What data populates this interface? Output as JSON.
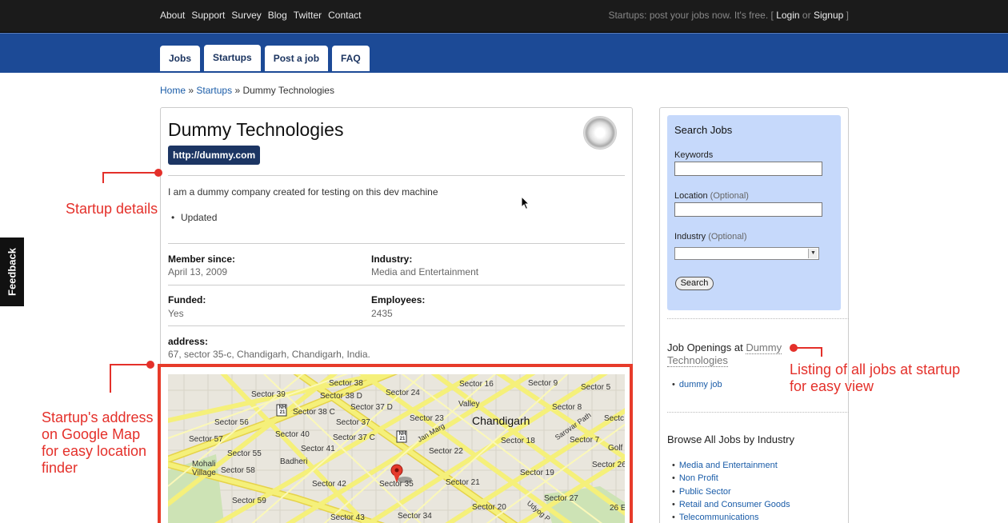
{
  "topbar": {
    "links": [
      "About",
      "Support",
      "Survey",
      "Blog",
      "Twitter",
      "Contact"
    ],
    "promo": "Startups: post your jobs now. It's free. [",
    "login": "Login",
    "or": "or",
    "signup": "Signup",
    "close_bracket": "]"
  },
  "tabs": [
    "Jobs",
    "Startups",
    "Post a job",
    "FAQ"
  ],
  "active_tab": "Startups",
  "breadcrumb": {
    "home": "Home",
    "sep": "»",
    "startups": "Startups",
    "current": "Dummy Technologies"
  },
  "company": {
    "name": "Dummy Technologies",
    "url": "http://dummy.com",
    "description": "I am a dummy company created for testing on this dev machine",
    "updates": [
      "Updated"
    ],
    "member_since_label": "Member since:",
    "member_since": "April 13, 2009",
    "industry_label": "Industry:",
    "industry": "Media and Entertainment",
    "funded_label": "Funded:",
    "funded": "Yes",
    "employees_label": "Employees:",
    "employees": "2435",
    "address_label": "address:",
    "address": "67, sector 35-c, Chandigarh, Chandigarh, India."
  },
  "map": {
    "labels": [
      "Sector 38",
      "Sector 39",
      "Sector 38 D",
      "Sector 24",
      "Sector 16",
      "Sector 9",
      "Sector 5",
      "Sector 38 C",
      "Sector 37 D",
      "Sector 56",
      "Sector 37",
      "Sector 23",
      "Chandigarh",
      "Sector 8",
      "Sector 40",
      "Sector 37 C",
      "Sector 57",
      "Sector 41",
      "Sector 22",
      "Sector 18",
      "Sector 7",
      "Sector 55",
      "Mohali Village",
      "Sector 58",
      "Badheri",
      "Sector 26",
      "Sector 42",
      "Sector 35",
      "Sector 21",
      "Sector 19",
      "Sector 59",
      "Sector 27",
      "Sector 20",
      "Sector 43",
      "Sector 34",
      "Sarovar Path",
      "Jan Marg",
      "Golf C",
      "Sectc",
      "Valley",
      "26 E",
      "Udyog P"
    ],
    "road_shields": [
      "NH 21",
      "NH 21"
    ],
    "road_color": "#f5f07a"
  },
  "sidebar": {
    "search_title": "Search Jobs",
    "keywords_label": "Keywords",
    "location_label": "Location",
    "location_opt": "(Optional)",
    "industry_label": "Industry",
    "industry_opt": "(Optional)",
    "search_button": "Search",
    "openings_prefix": "Job Openings at",
    "openings_company": "Dummy Technologies",
    "openings": [
      "dummy job"
    ],
    "browse_title": "Browse All Jobs by Industry",
    "industries": [
      "Media and Entertainment",
      "Non Profit",
      "Public Sector",
      "Retail and Consumer Goods",
      "Telecommunications"
    ]
  },
  "feedback": "Feedback",
  "annotations": {
    "startup_details": "Startup details",
    "address_map": [
      "Startup's address",
      "on Google Map",
      "for easy location",
      "finder"
    ],
    "listing": [
      "Listing of all jobs at startup",
      "for easy view"
    ],
    "color": "#e4302a"
  }
}
